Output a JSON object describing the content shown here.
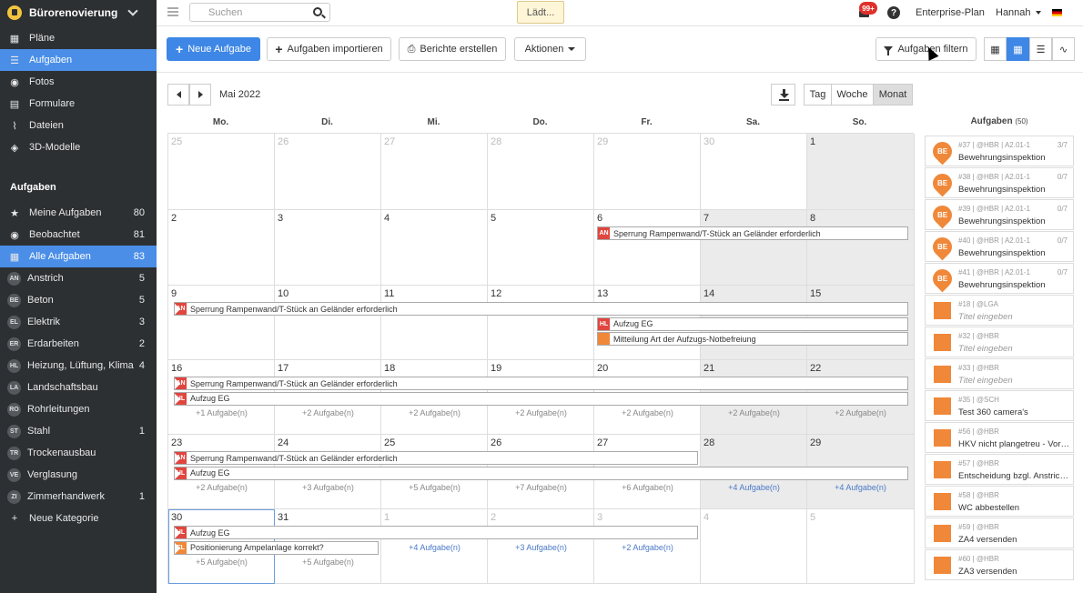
{
  "sidebar": {
    "project": "Bürorenovierung",
    "nav": [
      {
        "label": "Pläne",
        "icon": "plans-icon"
      },
      {
        "label": "Aufgaben",
        "icon": "list-icon"
      },
      {
        "label": "Fotos",
        "icon": "camera-icon"
      },
      {
        "label": "Formulare",
        "icon": "clipboard-icon"
      },
      {
        "label": "Dateien",
        "icon": "paperclip-icon"
      },
      {
        "label": "3D-Modelle",
        "icon": "cube-icon"
      }
    ],
    "section": "Aufgaben",
    "filters": [
      {
        "label": "Meine Aufgaben",
        "count": "80"
      },
      {
        "label": "Beobachtet",
        "count": "81"
      },
      {
        "label": "Alle Aufgaben",
        "count": "83"
      }
    ],
    "categories": [
      {
        "code": "AN",
        "label": "Anstrich",
        "count": "5"
      },
      {
        "code": "BE",
        "label": "Beton",
        "count": "5"
      },
      {
        "code": "EL",
        "label": "Elektrik",
        "count": "3"
      },
      {
        "code": "ER",
        "label": "Erdarbeiten",
        "count": "2"
      },
      {
        "code": "HL",
        "label": "Heizung, Lüftung, Klima",
        "count": "4"
      },
      {
        "code": "LA",
        "label": "Landschaftsbau",
        "count": ""
      },
      {
        "code": "RO",
        "label": "Rohrleitungen",
        "count": ""
      },
      {
        "code": "ST",
        "label": "Stahl",
        "count": "1"
      },
      {
        "code": "TR",
        "label": "Trockenausbau",
        "count": ""
      },
      {
        "code": "VE",
        "label": "Verglasung",
        "count": ""
      },
      {
        "code": "ZI",
        "label": "Zimmerhandwerk",
        "count": "1"
      }
    ],
    "new_category": "Neue Kategorie"
  },
  "topbar": {
    "search_placeholder": "Suchen",
    "loading": "Lädt...",
    "notifications": "99+",
    "help": "?",
    "plan": "Enterprise-Plan",
    "user": "Hannah"
  },
  "toolbar": {
    "new_task": "Neue Aufgabe",
    "import": "Aufgaben importieren",
    "reports": "Berichte erstellen",
    "actions": "Aktionen",
    "filter": "Aufgaben filtern"
  },
  "calendar": {
    "month": "Mai 2022",
    "views": [
      "Tag",
      "Woche",
      "Monat"
    ],
    "weekdays": [
      "Mo.",
      "Di.",
      "Mi.",
      "Do.",
      "Fr.",
      "Sa.",
      "So."
    ],
    "weeks": [
      [
        {
          "d": "25",
          "o": 1
        },
        {
          "d": "26",
          "o": 1
        },
        {
          "d": "27",
          "o": 1
        },
        {
          "d": "28",
          "o": 1
        },
        {
          "d": "29",
          "o": 1
        },
        {
          "d": "30",
          "o": 1
        },
        {
          "d": "1",
          "o": 0
        }
      ],
      [
        {
          "d": "2",
          "o": 0
        },
        {
          "d": "3",
          "o": 0
        },
        {
          "d": "4",
          "o": 0
        },
        {
          "d": "5",
          "o": 0
        },
        {
          "d": "6",
          "o": 0
        },
        {
          "d": "7",
          "o": 0
        },
        {
          "d": "8",
          "o": 0
        }
      ],
      [
        {
          "d": "9",
          "o": 0
        },
        {
          "d": "10",
          "o": 0
        },
        {
          "d": "11",
          "o": 0
        },
        {
          "d": "12",
          "o": 0
        },
        {
          "d": "13",
          "o": 0
        },
        {
          "d": "14",
          "o": 0
        },
        {
          "d": "15",
          "o": 0
        }
      ],
      [
        {
          "d": "16",
          "o": 0
        },
        {
          "d": "17",
          "o": 0
        },
        {
          "d": "18",
          "o": 0
        },
        {
          "d": "19",
          "o": 0
        },
        {
          "d": "20",
          "o": 0
        },
        {
          "d": "21",
          "o": 0
        },
        {
          "d": "22",
          "o": 0
        }
      ],
      [
        {
          "d": "23",
          "o": 0
        },
        {
          "d": "24",
          "o": 0
        },
        {
          "d": "25",
          "o": 0
        },
        {
          "d": "26",
          "o": 0
        },
        {
          "d": "27",
          "o": 0
        },
        {
          "d": "28",
          "o": 0
        },
        {
          "d": "29",
          "o": 0
        }
      ],
      [
        {
          "d": "30",
          "o": 0
        },
        {
          "d": "31",
          "o": 0
        },
        {
          "d": "1",
          "o": 1
        },
        {
          "d": "2",
          "o": 1
        },
        {
          "d": "3",
          "o": 1
        },
        {
          "d": "4",
          "o": 1
        },
        {
          "d": "5",
          "o": 1
        }
      ]
    ],
    "events": [
      {
        "week": 1,
        "start": 4,
        "end": 7,
        "lane": 0,
        "code": "AN",
        "color": "#e0463f",
        "title": "Sperrung Rampenwand/T-Stück an Geländer erforderlich",
        "left": false,
        "right": true
      },
      {
        "week": 2,
        "start": 0,
        "end": 7,
        "lane": 0,
        "code": "AN",
        "color": "#e0463f",
        "title": "Sperrung Rampenwand/T-Stück an Geländer erforderlich",
        "left": true,
        "right": true
      },
      {
        "week": 2,
        "start": 4,
        "end": 7,
        "lane": 1,
        "code": "HL",
        "color": "#e0463f",
        "title": "Aufzug EG",
        "left": false,
        "right": true
      },
      {
        "week": 2,
        "start": 4,
        "end": 7,
        "lane": 2,
        "code": "",
        "color": "#f0883a",
        "title": "Mitteilung Art der Aufzugs-Notbefreiung",
        "left": false,
        "right": true
      },
      {
        "week": 3,
        "start": 0,
        "end": 7,
        "lane": 0,
        "code": "AN",
        "color": "#e0463f",
        "title": "Sperrung Rampenwand/T-Stück an Geländer erforderlich",
        "left": true,
        "right": true
      },
      {
        "week": 3,
        "start": 0,
        "end": 7,
        "lane": 1,
        "code": "HL",
        "color": "#e0463f",
        "title": "Aufzug EG",
        "left": true,
        "right": true
      },
      {
        "week": 4,
        "start": 0,
        "end": 5,
        "lane": 0,
        "code": "AN",
        "color": "#e0463f",
        "title": "Sperrung Rampenwand/T-Stück an Geländer erforderlich",
        "left": true,
        "right": false
      },
      {
        "week": 4,
        "start": 0,
        "end": 7,
        "lane": 1,
        "code": "HL",
        "color": "#e0463f",
        "title": "Aufzug EG",
        "left": true,
        "right": true
      },
      {
        "week": 5,
        "start": 0,
        "end": 5,
        "lane": 0,
        "code": "HL",
        "color": "#e0463f",
        "title": "Aufzug EG",
        "left": true,
        "right": false
      },
      {
        "week": 5,
        "start": 0,
        "end": 2,
        "lane": 1,
        "code": "EL",
        "color": "#f0883a",
        "title": "Positionierung Ampelanlage korrekt?",
        "left": true,
        "right": false
      }
    ],
    "more": [
      {
        "week": 3,
        "lane": 2,
        "items": [
          {
            "c": 0,
            "t": "+1 Aufgabe(n)"
          },
          {
            "c": 1,
            "t": "+2 Aufgabe(n)"
          },
          {
            "c": 2,
            "t": "+2 Aufgabe(n)"
          },
          {
            "c": 3,
            "t": "+2 Aufgabe(n)"
          },
          {
            "c": 4,
            "t": "+2 Aufgabe(n)"
          },
          {
            "c": 5,
            "t": "+2 Aufgabe(n)"
          },
          {
            "c": 6,
            "t": "+2 Aufgabe(n)"
          }
        ]
      },
      {
        "week": 4,
        "lane": 2,
        "items": [
          {
            "c": 0,
            "t": "+2 Aufgabe(n)"
          },
          {
            "c": 1,
            "t": "+3 Aufgabe(n)"
          },
          {
            "c": 2,
            "t": "+5 Aufgabe(n)"
          },
          {
            "c": 3,
            "t": "+7 Aufgabe(n)"
          },
          {
            "c": 4,
            "t": "+6 Aufgabe(n)"
          },
          {
            "c": 5,
            "t": "+4 Aufgabe(n)",
            "b": 1
          },
          {
            "c": 6,
            "t": "+4 Aufgabe(n)",
            "b": 1
          }
        ]
      },
      {
        "week": 5,
        "lane": 1,
        "items": [
          {
            "c": 2,
            "t": "+4 Aufgabe(n)",
            "b": 1
          },
          {
            "c": 3,
            "t": "+3 Aufgabe(n)",
            "b": 1
          },
          {
            "c": 4,
            "t": "+2 Aufgabe(n)",
            "b": 1
          }
        ]
      },
      {
        "week": 5,
        "lane": 2,
        "items": [
          {
            "c": 0,
            "t": "+5 Aufgabe(n)"
          },
          {
            "c": 1,
            "t": "+5 Aufgabe(n)"
          }
        ]
      }
    ]
  },
  "tasks": {
    "title": "Aufgaben",
    "count": "(50)",
    "items": [
      {
        "pin": "BE",
        "meta": "#37 | @HBR | A2.01-1",
        "progress": "3/7",
        "title": "Bewehrungsinspektion",
        "placeholder": false
      },
      {
        "pin": "BE",
        "meta": "#38 | @HBR | A2.01-1",
        "progress": "0/7",
        "title": "Bewehrungsinspektion",
        "placeholder": false
      },
      {
        "pin": "BE",
        "meta": "#39 | @HBR | A2.01-1",
        "progress": "0/7",
        "title": "Bewehrungsinspektion",
        "placeholder": false
      },
      {
        "pin": "BE",
        "meta": "#40 | @HBR | A2.01-1",
        "progress": "0/7",
        "title": "Bewehrungsinspektion",
        "placeholder": false
      },
      {
        "pin": "BE",
        "meta": "#41 | @HBR | A2.01-1",
        "progress": "0/7",
        "title": "Bewehrungsinspektion",
        "placeholder": false
      },
      {
        "pin": "",
        "meta": "#18 | @LGA",
        "progress": "",
        "title": "Titel eingeben",
        "placeholder": true
      },
      {
        "pin": "",
        "meta": "#32 | @HBR",
        "progress": "",
        "title": "Titel eingeben",
        "placeholder": true
      },
      {
        "pin": "",
        "meta": "#33 | @HBR",
        "progress": "",
        "title": "Titel eingeben",
        "placeholder": true
      },
      {
        "pin": "",
        "meta": "#35 | @SCH",
        "progress": "",
        "title": "Test 360 camera's",
        "placeholder": false
      },
      {
        "pin": "",
        "meta": "#56 | @HBR",
        "progress": "",
        "title": "HKV nicht plangetreu - Vorgaben",
        "placeholder": false
      },
      {
        "pin": "",
        "meta": "#57 | @HBR",
        "progress": "",
        "title": "Entscheidung bzgl. Anstrich Flur",
        "placeholder": false
      },
      {
        "pin": "",
        "meta": "#58 | @HBR",
        "progress": "",
        "title": "WC abbestellen",
        "placeholder": false
      },
      {
        "pin": "",
        "meta": "#59 | @HBR",
        "progress": "",
        "title": "ZA4 versenden",
        "placeholder": false
      },
      {
        "pin": "",
        "meta": "#60 | @HBR",
        "progress": "",
        "title": "ZA3 versenden",
        "placeholder": false
      }
    ]
  }
}
